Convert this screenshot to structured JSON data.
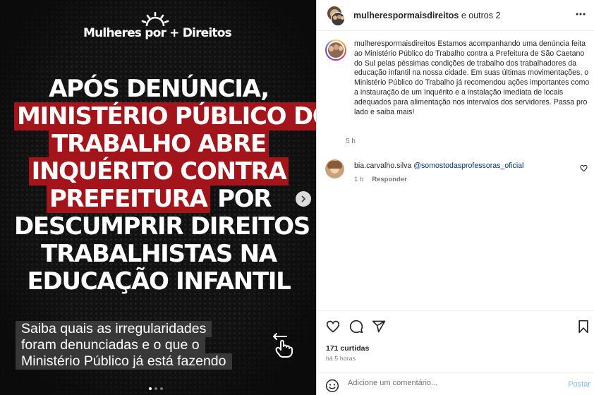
{
  "media": {
    "brand": "Mulheres por + Direitos",
    "headline_lines": [
      "APÓS DENÚNCIA,",
      "MINISTÉRIO PÚBLICO DO",
      "TRABALHO ABRE",
      "INQUÉRITO CONTRA",
      "PREFEITURA",
      " POR",
      "DESCUMPRIR DIREITOS",
      "TRABALHISTAS NA",
      "EDUCAÇÃO INFANTIL"
    ],
    "caption_lines": [
      "Saiba quais as irregularidades",
      "foram denunciadas e o que o",
      "Ministério Público já está fazendo"
    ],
    "highlight_color": "#a3141b",
    "carousel": {
      "count": 3,
      "active": 1
    }
  },
  "header": {
    "username": "mulherespormaisdireitos",
    "others": " e outros 2"
  },
  "caption": {
    "username": "mulherespormaisdireitos",
    "text": " Estamos acompanhando uma denúncia feita ao Ministério Público do Trabalho contra a Prefeitura de São Caetano do Sul pelas péssimas condições de trabalho dos trabalhadores da educação infantil na nossa cidade. Em suas últimas movimentações, o Ministério Público do Trabalho já recomendou ações importantes como a instauração de um Inquérito e a instalação imediata de locais adequados para alimentação nos intervalos dos servidores. Passa pro lado e saiba mais!",
    "time": "5 h"
  },
  "comment": {
    "username": "bia.carvalho.silva",
    "mention": "@somostodasprofessoras_oficial",
    "time": "1 h",
    "reply_label": "Responder"
  },
  "stats": {
    "likes": "171 curtidas",
    "posted": "há 5 horas"
  },
  "compose": {
    "placeholder": "Adicione um comentário...",
    "post_label": "Postar"
  },
  "icons": {
    "like": "heart-icon",
    "comment": "comment-icon",
    "share": "send-icon",
    "save": "bookmark-icon",
    "more": "more-icon",
    "emoji": "emoji-icon",
    "next": "chevron-right-icon",
    "swipe": "swipe-hand-icon"
  }
}
